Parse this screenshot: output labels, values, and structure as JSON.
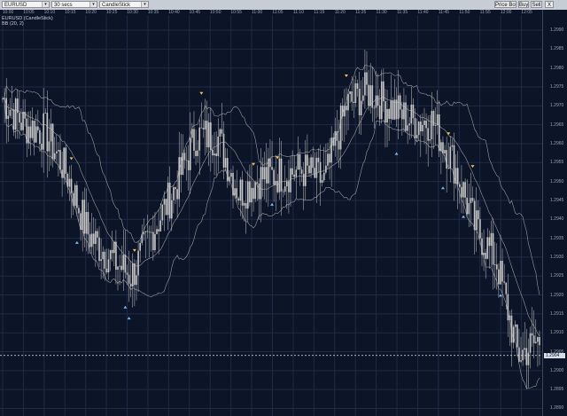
{
  "toolbar": {
    "symbol": "EURUSD",
    "interval": "30 secs",
    "chart_style": "CandleStick",
    "price_box_label": "Price Box",
    "buy_label": "Buy",
    "sell_label": "Sell",
    "close_label": "X"
  },
  "legend": {
    "line1": "EURUSD (CandleStick)",
    "line2": "BB (20, 2)"
  },
  "current_price_label": "1.2904",
  "colors": {
    "background": "#0c1427",
    "grid": "#1f2a46",
    "candle": "#c8c8c8",
    "bands": "#c8c8c8",
    "sell_marker": "#f0c060",
    "buy_marker": "#7ab8f0",
    "current_price_line": "#e8e8e8"
  },
  "chart_data": {
    "type": "candlestick",
    "symbol": "EURUSD",
    "indicator": "BB (20, 2)",
    "x_ticks": [
      "10:00",
      "10:05",
      "10:10",
      "10:15",
      "10:20",
      "10:25",
      "10:30",
      "10:35",
      "10:40",
      "10:45",
      "10:50",
      "10:55",
      "11:00",
      "11:05",
      "11:10",
      "11:15",
      "11:20",
      "11:25",
      "11:30",
      "11:35",
      "11:40",
      "11:45",
      "11:50",
      "11:55",
      "12:00",
      "12:05"
    ],
    "y_ticks": [
      "1.2990",
      "1.2985",
      "1.2980",
      "1.2975",
      "1.2970",
      "1.2965",
      "1.2960",
      "1.2955",
      "1.2950",
      "1.2945",
      "1.2940",
      "1.2935",
      "1.2930",
      "1.2925",
      "1.2920",
      "1.2915",
      "1.2910",
      "1.2905",
      "1.2900",
      "1.2895",
      "1.2890"
    ],
    "ylim": [
      1.2888,
      1.2994
    ],
    "current_price": 1.2904,
    "close_series": [
      {
        "t": "10:00",
        "close": 1.2972
      },
      {
        "t": "10:05",
        "close": 1.2965
      },
      {
        "t": "10:10",
        "close": 1.2963
      },
      {
        "t": "10:15",
        "close": 1.2952
      },
      {
        "t": "10:20",
        "close": 1.2936
      },
      {
        "t": "10:25",
        "close": 1.293
      },
      {
        "t": "10:30",
        "close": 1.2925
      },
      {
        "t": "10:35",
        "close": 1.2937
      },
      {
        "t": "10:40",
        "close": 1.2948
      },
      {
        "t": "10:45",
        "close": 1.2962
      },
      {
        "t": "10:50",
        "close": 1.2962
      },
      {
        "t": "10:55",
        "close": 1.2947
      },
      {
        "t": "11:00",
        "close": 1.2951
      },
      {
        "t": "11:05",
        "close": 1.2952
      },
      {
        "t": "11:10",
        "close": 1.2953
      },
      {
        "t": "11:15",
        "close": 1.295
      },
      {
        "t": "11:20",
        "close": 1.297
      },
      {
        "t": "11:25",
        "close": 1.2974
      },
      {
        "t": "11:30",
        "close": 1.297
      },
      {
        "t": "11:35",
        "close": 1.2966
      },
      {
        "t": "11:40",
        "close": 1.2966
      },
      {
        "t": "11:45",
        "close": 1.2955
      },
      {
        "t": "11:50",
        "close": 1.2938
      },
      {
        "t": "11:55",
        "close": 1.2929
      },
      {
        "t": "12:00",
        "close": 1.2904
      },
      {
        "t": "12:05",
        "close": 1.2908
      }
    ],
    "grid": true
  }
}
